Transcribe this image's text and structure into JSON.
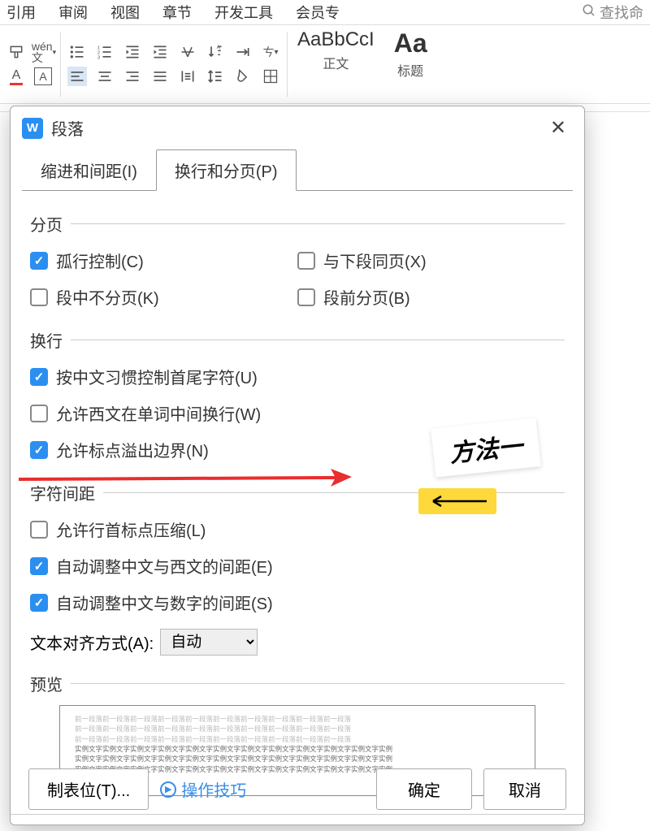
{
  "ribbon": {
    "tabs": [
      "引用",
      "审阅",
      "视图",
      "章节",
      "开发工具",
      "会员专"
    ],
    "search": "查找命"
  },
  "styles": {
    "normal": {
      "preview": "AaBbCcI",
      "label": "正文"
    },
    "heading": {
      "preview": "Aa",
      "label": "标题"
    }
  },
  "dialog": {
    "title": "段落",
    "tabs": {
      "indent": "缩进和间距(I)",
      "line": "换行和分页(P)"
    },
    "sections": {
      "pagination": "分页",
      "linebreak": "换行",
      "spacing": "字符间距",
      "preview": "预览"
    },
    "checkboxes": {
      "orphan": "孤行控制(C)",
      "keepnext": "与下段同页(X)",
      "keeptogether": "段中不分页(K)",
      "pagebreak": "段前分页(B)",
      "cjk": "按中文习惯控制首尾字符(U)",
      "wordwrap": "允许西文在单词中间换行(W)",
      "hangpunct": "允许标点溢出边界(N)",
      "compress": "允许行首标点压缩(L)",
      "autospace_en": "自动调整中文与西文的间距(E)",
      "autospace_num": "自动调整中文与数字的间距(S)"
    },
    "align": {
      "label": "文本对齐方式(A):",
      "value": "自动"
    },
    "preview_text": {
      "light": "前一段落前一段落前一段落前一段落前一段落前一段落前一段落前一段落前一段落前一段落",
      "dark": "实例文字实例文字实例文字实例文字实例文字实例文字实例文字实例文字实例文字实例文字实例文字实例"
    },
    "buttons": {
      "tab": "制表位(T)...",
      "tips": "操作技巧",
      "ok": "确定",
      "cancel": "取消"
    }
  },
  "annotation": {
    "label": "方法一"
  }
}
